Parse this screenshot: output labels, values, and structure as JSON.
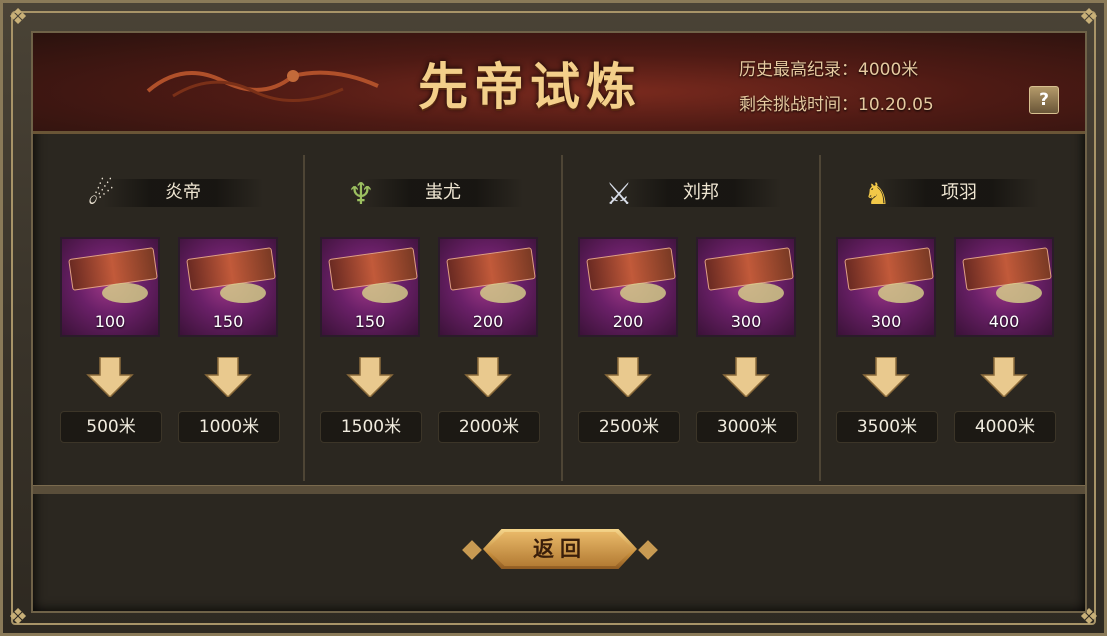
{
  "header": {
    "title": "先帝试炼",
    "record_label": "历史最高纪录：4000米",
    "time_label": "剩余挑战时间：10.20.05",
    "help_label": "?"
  },
  "panels": [
    {
      "name": "炎帝",
      "icon": "fire-emperor-icon",
      "icon_color": "#e8e0d0",
      "rewards": [
        {
          "value": "100",
          "distance": "500米"
        },
        {
          "value": "150",
          "distance": "1000米"
        }
      ]
    },
    {
      "name": "蚩尤",
      "icon": "chiyou-icon",
      "icon_color": "#9cc060",
      "rewards": [
        {
          "value": "150",
          "distance": "1500米"
        },
        {
          "value": "200",
          "distance": "2000米"
        }
      ]
    },
    {
      "name": "刘邦",
      "icon": "liubang-icon",
      "icon_color": "#d8dde8",
      "rewards": [
        {
          "value": "200",
          "distance": "2500米"
        },
        {
          "value": "300",
          "distance": "3000米"
        }
      ]
    },
    {
      "name": "项羽",
      "icon": "xiangyu-icon",
      "icon_color": "#f2c848",
      "rewards": [
        {
          "value": "300",
          "distance": "3500米"
        },
        {
          "value": "400",
          "distance": "4000米"
        }
      ]
    }
  ],
  "footer": {
    "return_label": "返回"
  },
  "colors": {
    "accent": "#f3cf8a",
    "arrow": "#e9c98e",
    "item_bg": "#6a2068"
  }
}
